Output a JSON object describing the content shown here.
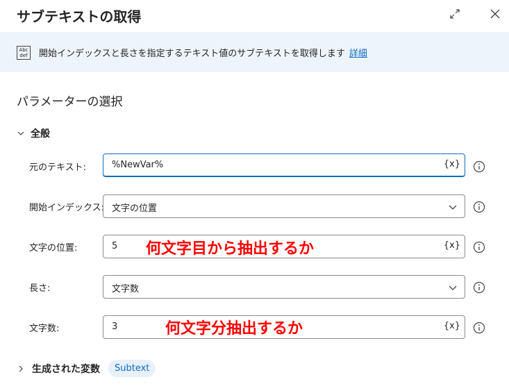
{
  "dialog": {
    "title": "サブテキストの取得",
    "description": "開始インデックスと長さを指定するテキスト値のサブテキストを取得します",
    "details_link": "詳細",
    "section_title": "パラメーターの選択",
    "group_label": "全般"
  },
  "fields": {
    "original_text": {
      "label": "元のテキスト:",
      "value": "%NewVar%",
      "var_button": "{x}"
    },
    "start_index": {
      "label": "開始インデックス:",
      "value": "文字の位置"
    },
    "char_position": {
      "label": "文字の位置:",
      "value": "5",
      "var_button": "{x}"
    },
    "length": {
      "label": "長さ:",
      "value": "文字数"
    },
    "char_count": {
      "label": "文字数:",
      "value": "3",
      "var_button": "{x}"
    }
  },
  "annotations": {
    "position_note": "何文字目から抽出するか",
    "count_note": "何文字分抽出するか"
  },
  "output": {
    "label": "生成された変数",
    "variable": "Subtext"
  },
  "icons": {
    "abc_icon_text": "Abc def"
  },
  "colors": {
    "accent": "#0f6cbd",
    "info_bar_bg": "#eef4fc",
    "annotation": "#ff0000"
  }
}
